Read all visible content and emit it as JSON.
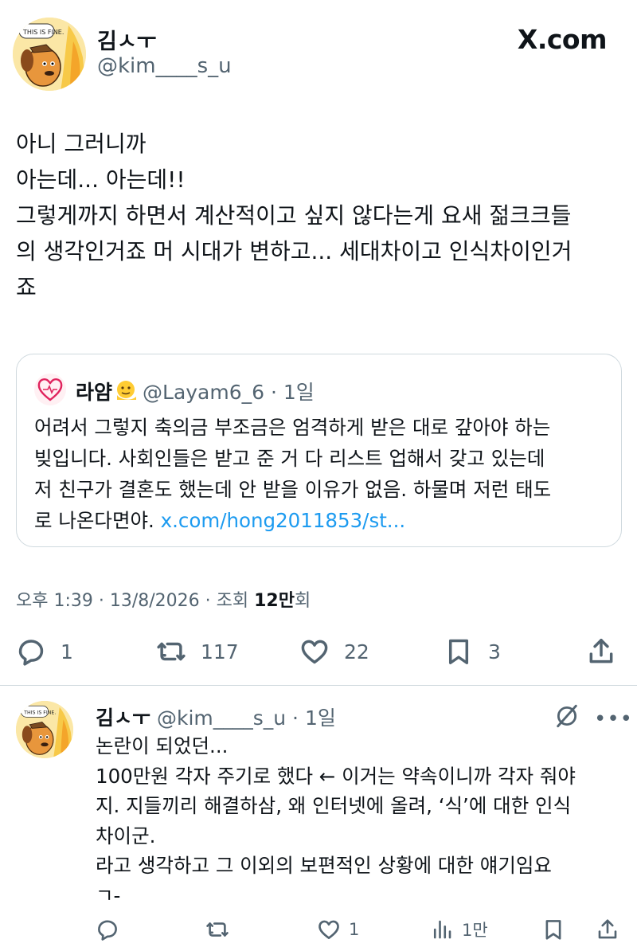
{
  "site": {
    "brand": "X.com"
  },
  "main_tweet": {
    "author_name": "김ㅅㅜ",
    "handle": "@kim____s_u",
    "body_lines": [
      "아니 그러니까",
      "아는데... 아는데!!",
      "그렇게까지 하면서 계산적이고 싶지 않다는게 요새 젊크크들",
      "의 생각인거죠 머 시대가 변하고...  세대차이고 인식차이인거",
      "죠"
    ],
    "timestamp": "오후 1:39 · 13/8/2026 · 조회 ",
    "views": "12만",
    "views_suffix": "회",
    "actions": {
      "replies": "1",
      "retweets": "117",
      "likes": "22",
      "bookmarks": "3"
    }
  },
  "quoted_tweet": {
    "author_name": "라얌",
    "meta": "@Layam6_6 · 1일",
    "body_lines": [
      "어려서 그렇지 축의금 부조금은 엄격하게 받은 대로 갚아야 하는",
      "빚입니다. 사회인들은 받고 준 거 다 리스트 업해서 갖고 있는데",
      "저 친구가 결혼도 했는데 안 받을 이유가 없음. 하물며 저런 태도"
    ],
    "last_line_text": "로 나온다면야. ",
    "link_text": "x.com/hong2011853/st..."
  },
  "reply": {
    "author_name": "김ㅅㅜ",
    "meta": "@kim____s_u · 1일",
    "body_lines": [
      "논란이 되었던...",
      "100만원 각자 주기로 했다 ← 이거는 약속이니까 각자 줘야",
      "지. 지들끼리 해결하삼, 왜 인터넷에 올려, ‘식’에 대한 인식",
      "차이군.",
      "라고 생각하고 그 이외의 보편적인 상황에 대한 얘기임요",
      "ㄱ-"
    ],
    "actions": {
      "likes": "1",
      "views": "1만"
    }
  },
  "colors": {
    "text": "#0f1419",
    "secondary": "#536471",
    "link": "#1d9bf0",
    "border": "#cfd9de"
  }
}
